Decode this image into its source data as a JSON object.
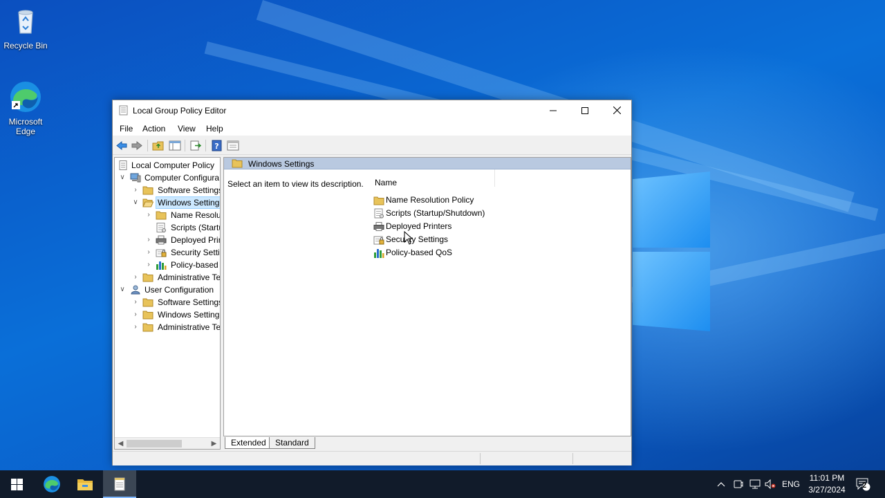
{
  "desktop": {
    "icons": [
      {
        "label": "Recycle Bin",
        "icon": "recycle-bin-icon"
      },
      {
        "label": "Microsoft\nEdge",
        "label_line1": "Microsoft",
        "label_line2": "Edge",
        "icon": "edge-icon"
      }
    ]
  },
  "window": {
    "title": "Local Group Policy Editor",
    "menu": [
      "File",
      "Action",
      "View",
      "Help"
    ],
    "toolbar_icons": [
      "back-arrow-icon",
      "forward-arrow-icon",
      "up-folder-icon",
      "show-hide-tree-icon",
      "export-list-icon",
      "help-icon",
      "properties-icon"
    ]
  },
  "tree": {
    "root": "Local Computer Policy",
    "nodes": [
      {
        "label": "Computer Configura",
        "icon": "computer-icon",
        "state": "expanded",
        "level": 1
      },
      {
        "label": "Software Settings",
        "icon": "folder-icon",
        "state": "collapsed",
        "level": 2
      },
      {
        "label": "Windows Setting",
        "icon": "folder-open-icon",
        "state": "expanded",
        "level": 2,
        "selected": true
      },
      {
        "label": "Name Resolut",
        "icon": "folder-icon",
        "state": "collapsed",
        "level": 3
      },
      {
        "label": "Scripts (Startu",
        "icon": "scripts-icon",
        "state": "none",
        "level": 3
      },
      {
        "label": "Deployed Prir",
        "icon": "printer-icon",
        "state": "collapsed",
        "level": 3
      },
      {
        "label": "Security Settir",
        "icon": "security-icon",
        "state": "collapsed",
        "level": 3
      },
      {
        "label": "Policy-based",
        "icon": "chart-icon",
        "state": "collapsed",
        "level": 3
      },
      {
        "label": "Administrative Te",
        "icon": "folder-icon",
        "state": "collapsed",
        "level": 2
      },
      {
        "label": "User Configuration",
        "icon": "user-icon",
        "state": "expanded",
        "level": 1
      },
      {
        "label": "Software Settings",
        "icon": "folder-icon",
        "state": "collapsed",
        "level": 2
      },
      {
        "label": "Windows Setting",
        "icon": "folder-icon",
        "state": "collapsed",
        "level": 2
      },
      {
        "label": "Administrative Te",
        "icon": "folder-icon",
        "state": "collapsed",
        "level": 2
      }
    ]
  },
  "right_pane": {
    "header": "Windows Settings",
    "description": "Select an item to view its description.",
    "column_name": "Name",
    "items": [
      {
        "label": "Name Resolution Policy",
        "icon": "folder-icon"
      },
      {
        "label": "Scripts (Startup/Shutdown)",
        "icon": "scripts-icon"
      },
      {
        "label": "Deployed Printers",
        "icon": "printer-icon"
      },
      {
        "label": "Security Settings",
        "icon": "security-icon"
      },
      {
        "label": "Policy-based QoS",
        "icon": "chart-icon"
      }
    ],
    "tabs": [
      {
        "label": "Extended",
        "active": true
      },
      {
        "label": "Standard",
        "active": false
      }
    ]
  },
  "taskbar": {
    "language": "ENG",
    "time": "11:01 PM",
    "date": "3/27/2024",
    "notification_count": "2"
  },
  "colors": {
    "selection": "#cce8ff",
    "header_band": "#b9c9e0",
    "taskbar": "#111b2a",
    "folder": "#e8c35a"
  }
}
